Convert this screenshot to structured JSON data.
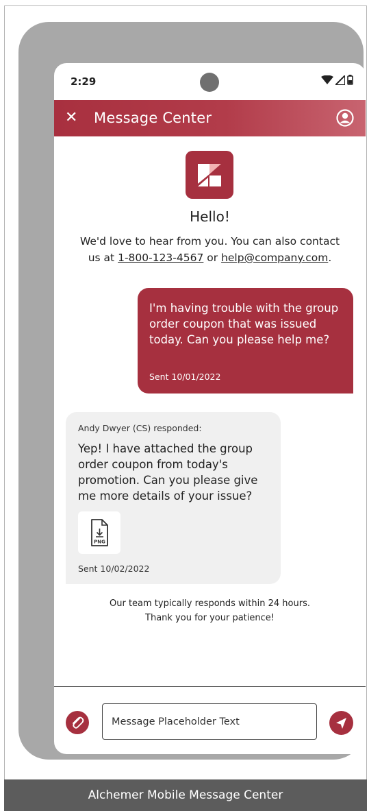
{
  "status_bar": {
    "time": "2:29"
  },
  "header": {
    "title": "Message Center",
    "close_icon": "close-icon",
    "profile_icon": "profile-icon"
  },
  "greeting": "Hello!",
  "intro": {
    "line1": "We'd love to hear from you. You can also contact",
    "prefix": "us at ",
    "phone": "1-800-123-4567",
    "mid": " or ",
    "email": "help@company.com",
    "suffix": "."
  },
  "messages": [
    {
      "direction": "outgoing",
      "text": "I'm having trouble with the group order coupon that was issued today. Can you please help me?",
      "sent": "Sent 10/01/2022"
    },
    {
      "direction": "incoming",
      "author": "Andy Dwyer (CS) responded:",
      "text": "Yep! I have attached the group order coupon from today's promotion. Can you please give me more details of your issue?",
      "attachment_label": "PNG",
      "sent": "Sent 10/02/2022"
    }
  ],
  "footer_note": {
    "line1": "Our team typically responds within 24 hours.",
    "line2": "Thank you for your patience!"
  },
  "composer": {
    "placeholder": "Message Placeholder Text"
  },
  "caption": "Alchemer Mobile Message Center",
  "colors": {
    "accent": "#a6303f",
    "bubble_in": "#f0f0f0",
    "phone_frame": "#a8a8a8",
    "caption_bg": "#5c5c5c"
  }
}
